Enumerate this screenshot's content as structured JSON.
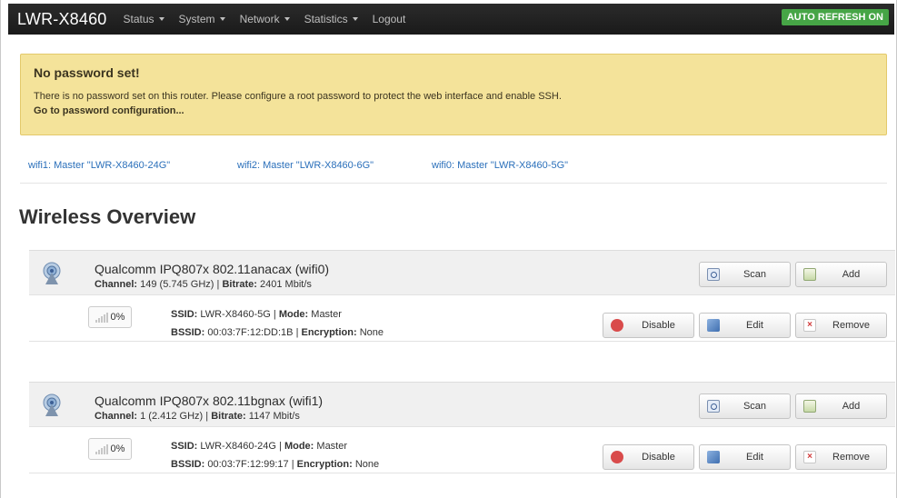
{
  "navbar": {
    "brand": "LWR-X8460",
    "menu": [
      {
        "label": "Status",
        "dropdown": true
      },
      {
        "label": "System",
        "dropdown": true
      },
      {
        "label": "Network",
        "dropdown": true
      },
      {
        "label": "Statistics",
        "dropdown": true
      },
      {
        "label": "Logout",
        "dropdown": false
      }
    ],
    "auto_refresh": "AUTO REFRESH ON"
  },
  "alert": {
    "title": "No password set!",
    "text": "There is no password set on this router. Please configure a root password to protect the web interface and enable SSH.",
    "link": "Go to password configuration..."
  },
  "tabs": [
    "wifi1: Master \"LWR-X8460-24G\"",
    "wifi2: Master \"LWR-X8460-6G\"",
    "wifi0: Master \"LWR-X8460-5G\""
  ],
  "page_title": "Wireless Overview",
  "labels": {
    "channel": "Channel:",
    "bitrate": "Bitrate:",
    "ssid": "SSID:",
    "mode": "Mode:",
    "bssid": "BSSID:",
    "encryption": "Encryption:",
    "sep": " | ",
    "scan": "Scan",
    "add": "Add",
    "disable": "Disable",
    "edit": "Edit",
    "remove": "Remove"
  },
  "devices": [
    {
      "name": "Qualcomm IPQ807x 802.11anacax (wifi0)",
      "channel": "149 (5.745 GHz)",
      "bitrate": "2401 Mbit/s",
      "network": {
        "signal": "0%",
        "ssid": "LWR-X8460-5G",
        "mode": "Master",
        "bssid": "00:03:7F:12:DD:1B",
        "encryption": "None"
      }
    },
    {
      "name": "Qualcomm IPQ807x 802.11bgnax (wifi1)",
      "channel": "1 (2.412 GHz)",
      "bitrate": "1147 Mbit/s",
      "network": {
        "signal": "0%",
        "ssid": "LWR-X8460-24G",
        "mode": "Master",
        "bssid": "00:03:7F:12:99:17",
        "encryption": "None"
      }
    }
  ]
}
